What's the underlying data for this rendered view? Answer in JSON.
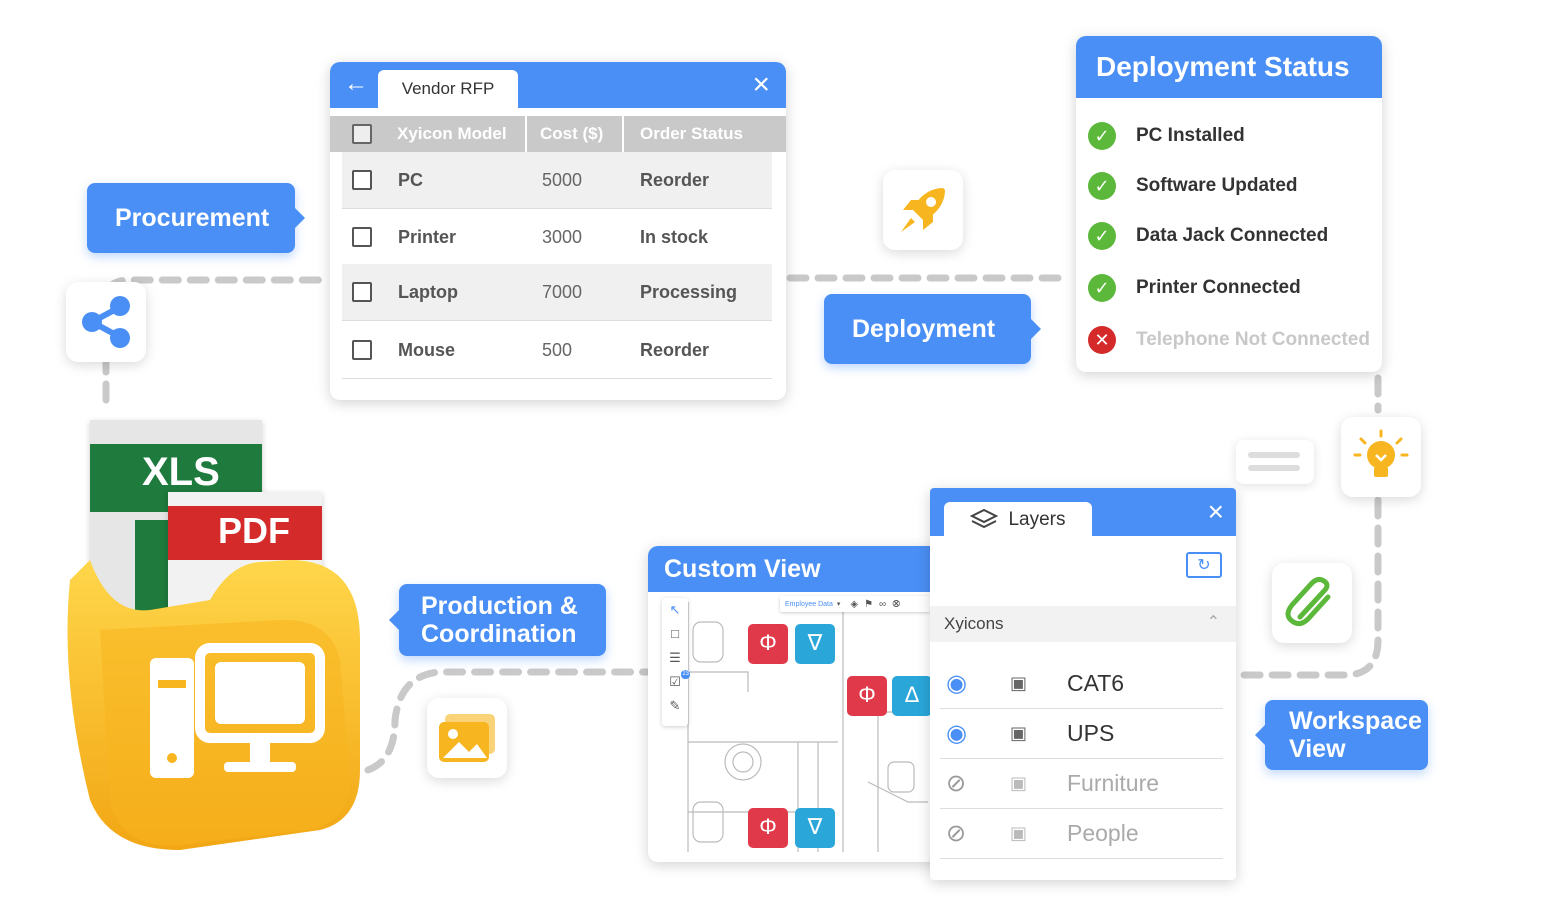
{
  "vendor": {
    "tab_label": "Vendor RFP",
    "columns": [
      "Xyicon Model",
      "Cost ($)",
      "Order Status"
    ],
    "rows": [
      {
        "model": "PC",
        "cost": "5000",
        "status": "Reorder"
      },
      {
        "model": "Printer",
        "cost": "3000",
        "status": "In stock"
      },
      {
        "model": "Laptop",
        "cost": "7000",
        "status": "Processing"
      },
      {
        "model": "Mouse",
        "cost": "500",
        "status": "Reorder"
      }
    ]
  },
  "labels": {
    "procurement": "Procurement",
    "deployment": "Deployment",
    "production_line1": "Production &",
    "production_line2": "Coordination",
    "workspace_line1": "Workspace",
    "workspace_line2": "View"
  },
  "deployment_status": {
    "title": "Deployment Status",
    "items": [
      {
        "label": "PC Installed",
        "ok": true
      },
      {
        "label": "Software Updated",
        "ok": true
      },
      {
        "label": "Data Jack Connected",
        "ok": true
      },
      {
        "label": "Printer Connected",
        "ok": true
      },
      {
        "label": "Telephone Not Connected",
        "ok": false
      }
    ]
  },
  "custom_view": {
    "title": "Custom View",
    "toolbar_dropdown": "Employee Data",
    "badge_count": "23",
    "symbols": [
      {
        "code": "UPS"
      },
      {
        "code": "CAT6"
      }
    ]
  },
  "layers": {
    "tab_label": "Layers",
    "section": "Xyicons",
    "items": [
      {
        "label": "CAT6",
        "visible": true
      },
      {
        "label": "UPS",
        "visible": true
      },
      {
        "label": "Furniture",
        "visible": false
      },
      {
        "label": "People",
        "visible": false
      }
    ]
  },
  "files": {
    "xls": "XLS",
    "pdf": "PDF",
    "xls_partial": "X"
  },
  "colors": {
    "accent": "#4a8ff5",
    "success": "#5cb83a",
    "error": "#d42a2a",
    "folder": "#f7b51f",
    "xls_green": "#1f7a3d",
    "pdf_red": "#d42a2a",
    "ups_red": "#e03a4a",
    "cat6_blue": "#2aa6d9"
  }
}
